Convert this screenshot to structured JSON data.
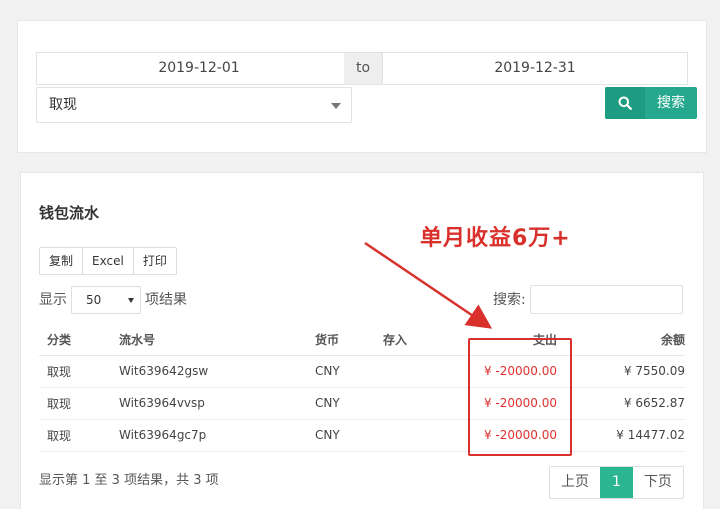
{
  "filter": {
    "start_date": "2019-12-01",
    "separator": "to",
    "end_date": "2019-12-31",
    "type_value": "取现",
    "search_button": "搜索"
  },
  "wallet": {
    "title": "钱包流水",
    "tools": [
      "复制",
      "Excel",
      "打印"
    ],
    "length_prefix": "显示",
    "length_value": "50",
    "length_suffix": "项结果",
    "search_label": "搜索:",
    "columns": [
      "分类",
      "流水号",
      "货币",
      "存入",
      "支出",
      "余额"
    ],
    "rows": [
      {
        "type": "取现",
        "serial": "Wit639642gsw",
        "currency": "CNY",
        "deposit": "",
        "expense": "¥ -20000.00",
        "balance": "¥ 7550.09"
      },
      {
        "type": "取现",
        "serial": "Wit63964vvsp",
        "currency": "CNY",
        "deposit": "",
        "expense": "¥ -20000.00",
        "balance": "¥ 6652.87"
      },
      {
        "type": "取现",
        "serial": "Wit63964gc7p",
        "currency": "CNY",
        "deposit": "",
        "expense": "¥ -20000.00",
        "balance": "¥ 14477.02"
      }
    ],
    "info": "显示第 1 至 3 项结果，共 3 项",
    "pager": {
      "prev": "上页",
      "current": "1",
      "next": "下页"
    }
  },
  "annotation": {
    "text": "单月收益6万+",
    "color": "#d9302c"
  }
}
